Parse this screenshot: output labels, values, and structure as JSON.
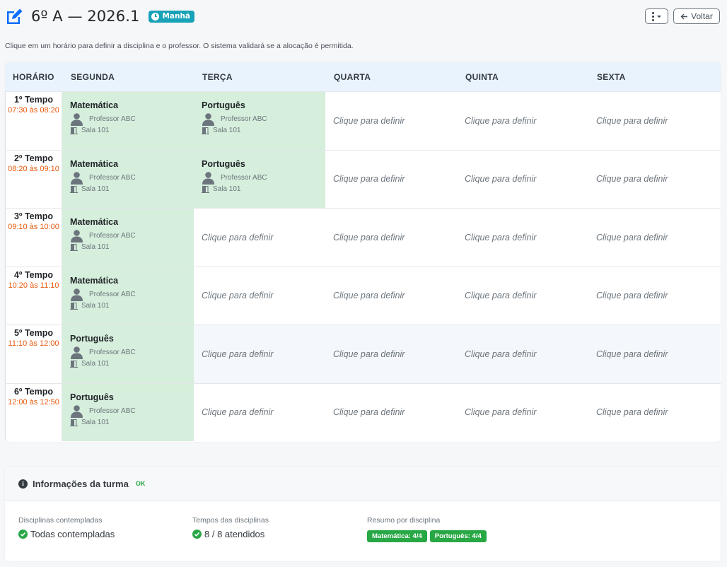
{
  "header": {
    "title": "6º A — 2026.1",
    "shift_badge": "Manhã",
    "more_button_icon": "vertical-dots-icon",
    "back_label": "Voltar"
  },
  "instructions": "Clique em um horário para definir a disciplina e o professor. O sistema validará se a alocação é permitida.",
  "schedule": {
    "time_header": "HORÁRIO",
    "days": [
      "SEGUNDA",
      "TERÇA",
      "QUARTA",
      "QUINTA",
      "SEXTA"
    ],
    "placeholder": "Clique para definir",
    "rows": [
      {
        "period": "1º Tempo",
        "range": "07:30 às 08:20",
        "cells": [
          {
            "subject": "Matemática",
            "teacher": "Professor ABC",
            "room": "Sala 101"
          },
          {
            "subject": "Português",
            "teacher": "Professor ABC",
            "room": "Sala 101"
          },
          null,
          null,
          null
        ]
      },
      {
        "period": "2º Tempo",
        "range": "08:20 às 09:10",
        "cells": [
          {
            "subject": "Matemática",
            "teacher": "Professor ABC",
            "room": "Sala 101"
          },
          {
            "subject": "Português",
            "teacher": "Professor ABC",
            "room": "Sala 101"
          },
          null,
          null,
          null
        ]
      },
      {
        "period": "3º Tempo",
        "range": "09:10 às 10:00",
        "cells": [
          {
            "subject": "Matemática",
            "teacher": "Professor ABC",
            "room": "Sala 101"
          },
          null,
          null,
          null,
          null
        ]
      },
      {
        "period": "4º Tempo",
        "range": "10:20 às 11:10",
        "cells": [
          {
            "subject": "Matemática",
            "teacher": "Professor ABC",
            "room": "Sala 101"
          },
          null,
          null,
          null,
          null
        ]
      },
      {
        "period": "5º Tempo",
        "range": "11:10 às 12:00",
        "cells": [
          {
            "subject": "Português",
            "teacher": "Professor ABC",
            "room": "Sala 101"
          },
          null,
          null,
          null,
          null
        ]
      },
      {
        "period": "6º Tempo",
        "range": "12:00 às 12:50",
        "cells": [
          {
            "subject": "Português",
            "teacher": "Professor ABC",
            "room": "Sala 101"
          },
          null,
          null,
          null,
          null
        ]
      }
    ]
  },
  "info": {
    "title": "Informações da turma",
    "status": "OK",
    "disciplines_label": "Disciplinas contempladas",
    "disciplines_value": "Todas contempladas",
    "periods_label": "Tempos das disciplinas",
    "periods_value": "8 / 8 atendidos",
    "summary_label": "Resumo por disciplina",
    "summary_badges": [
      "Matemática: 4/4",
      "Português: 4/4"
    ]
  },
  "colors": {
    "accent": "#0d6efd",
    "filled_cell": "#d6eedc",
    "time_range": "#e8590c",
    "success": "#28a745",
    "shift_badge": "#17a2b8"
  }
}
